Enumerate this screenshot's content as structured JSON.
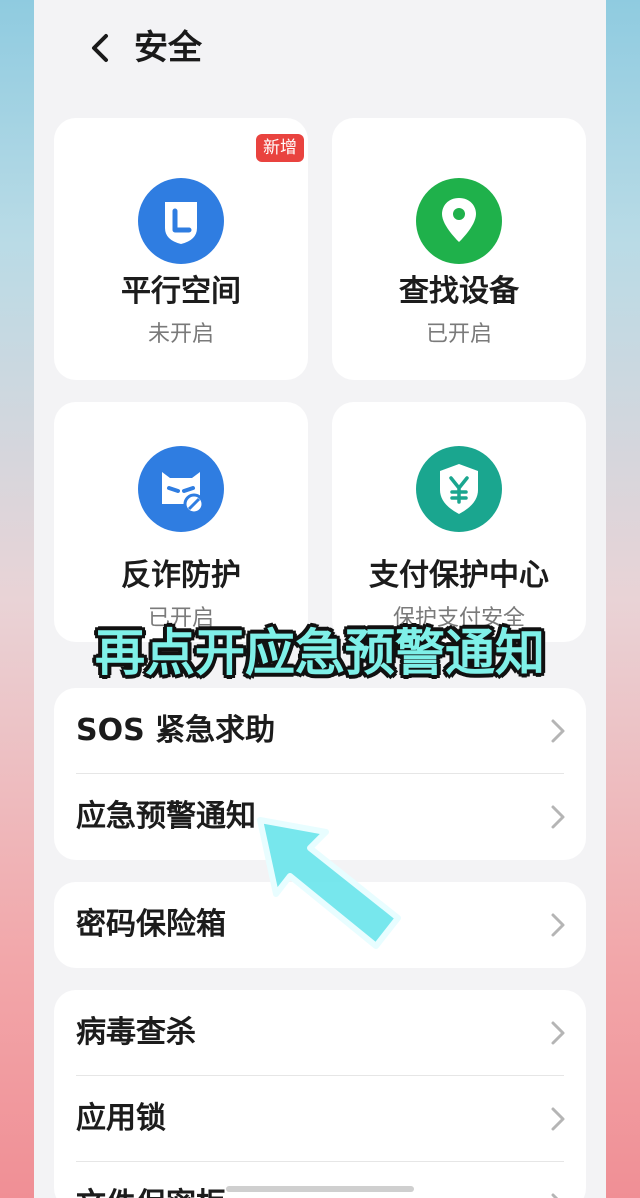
{
  "header": {
    "title": "安全"
  },
  "tiles": [
    {
      "name": "平行空间",
      "status": "未开启",
      "badge": "新增",
      "icon": "parallel-space-icon",
      "color": "#2f7de1"
    },
    {
      "name": "查找设备",
      "status": "已开启",
      "icon": "location-pin-icon",
      "color": "#1fb14b"
    },
    {
      "name": "反诈防护",
      "status": "已开启",
      "icon": "anti-fraud-icon",
      "color": "#2f7de1"
    },
    {
      "name": "支付保护中心",
      "status": "保护支付安全",
      "icon": "payment-shield-icon",
      "color": "#1aa68f"
    }
  ],
  "groups": [
    {
      "items": [
        "SOS 紧急求助",
        "应急预警通知"
      ]
    },
    {
      "items": [
        "密码保险箱"
      ]
    },
    {
      "items": [
        "病毒查杀",
        "应用锁",
        "文件保密柜"
      ]
    }
  ],
  "overlay": {
    "caption": "再点开应急预警通知"
  }
}
